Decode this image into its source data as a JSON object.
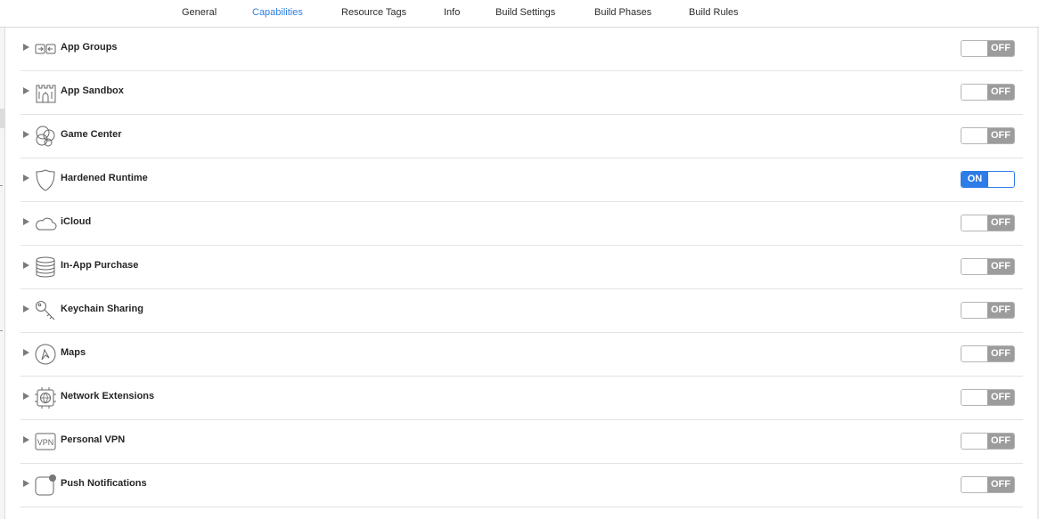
{
  "tabs": [
    {
      "label": "General",
      "active": false
    },
    {
      "label": "Capabilities",
      "active": true
    },
    {
      "label": "Resource Tags",
      "active": false
    },
    {
      "label": "Info",
      "active": false
    },
    {
      "label": "Build Settings",
      "active": false
    },
    {
      "label": "Build Phases",
      "active": false
    },
    {
      "label": "Build Rules",
      "active": false
    }
  ],
  "capabilities": [
    {
      "label": "App Groups",
      "icon": "app-groups-icon",
      "state": "OFF",
      "enabled": false
    },
    {
      "label": "App Sandbox",
      "icon": "app-sandbox-icon",
      "state": "OFF",
      "enabled": false
    },
    {
      "label": "Game Center",
      "icon": "game-center-icon",
      "state": "OFF",
      "enabled": false
    },
    {
      "label": "Hardened Runtime",
      "icon": "hardened-runtime-icon",
      "state": "ON",
      "enabled": true
    },
    {
      "label": "iCloud",
      "icon": "icloud-icon",
      "state": "OFF",
      "enabled": false
    },
    {
      "label": "In-App Purchase",
      "icon": "in-app-purchase-icon",
      "state": "OFF",
      "enabled": false
    },
    {
      "label": "Keychain Sharing",
      "icon": "keychain-sharing-icon",
      "state": "OFF",
      "enabled": false
    },
    {
      "label": "Maps",
      "icon": "maps-icon",
      "state": "OFF",
      "enabled": false
    },
    {
      "label": "Network Extensions",
      "icon": "network-extensions-icon",
      "state": "OFF",
      "enabled": false
    },
    {
      "label": "Personal VPN",
      "icon": "personal-vpn-icon",
      "state": "OFF",
      "enabled": false,
      "icon_text": "VPN"
    },
    {
      "label": "Push Notifications",
      "icon": "push-notifications-icon",
      "state": "OFF",
      "enabled": false
    }
  ],
  "colors": {
    "accent": "#2d7ce8",
    "off_fill": "#9c9c9c",
    "active_tab": "#2f7de1"
  }
}
